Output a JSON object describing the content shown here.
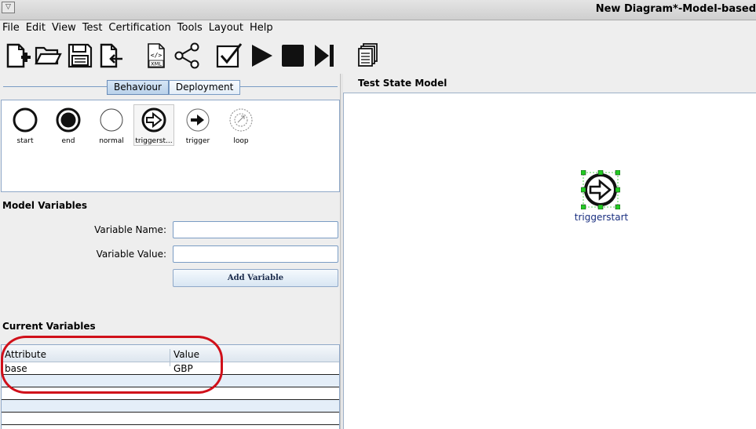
{
  "window": {
    "title": "New Diagram*-Model-based"
  },
  "menu": [
    "File",
    "Edit",
    "View",
    "Test",
    "Certification",
    "Tools",
    "Layout",
    "Help"
  ],
  "toolbar": {
    "xml_label": "XML",
    "icons": [
      "new-diagram-icon",
      "open-folder-icon",
      "save-icon",
      "export-icon",
      "xml-file-icon",
      "share-icon",
      "validate-check-icon",
      "play-icon",
      "stop-icon",
      "step-forward-icon",
      "documents-icon"
    ]
  },
  "tabs": {
    "behaviour": "Behaviour",
    "deployment": "Deployment",
    "active": "Behaviour"
  },
  "palette": {
    "items": [
      {
        "label": "start",
        "icon": "start-state-icon"
      },
      {
        "label": "end",
        "icon": "end-state-icon"
      },
      {
        "label": "normal",
        "icon": "normal-state-icon"
      },
      {
        "label": "triggerst...",
        "icon": "trigger-start-icon"
      },
      {
        "label": "trigger",
        "icon": "trigger-icon"
      },
      {
        "label": "loop",
        "icon": "loop-icon"
      }
    ]
  },
  "model_variables": {
    "title": "Model Variables",
    "name_label": "Variable Name:",
    "name_value": "",
    "value_label": "Variable Value:",
    "value_value": "",
    "add_button": "Add Variable"
  },
  "current_variables": {
    "title": "Current Variables",
    "columns": [
      "Attribute",
      "Value"
    ],
    "rows": [
      {
        "attribute": "base",
        "value": "GBP"
      }
    ]
  },
  "canvas": {
    "title": "Test State Model",
    "node_label": "triggerstart"
  },
  "colors": {
    "annotation": "#d0101a",
    "selection_handle": "#22cc22",
    "node_label": "#1a2f80",
    "tab_active": "#b9d1ea"
  }
}
